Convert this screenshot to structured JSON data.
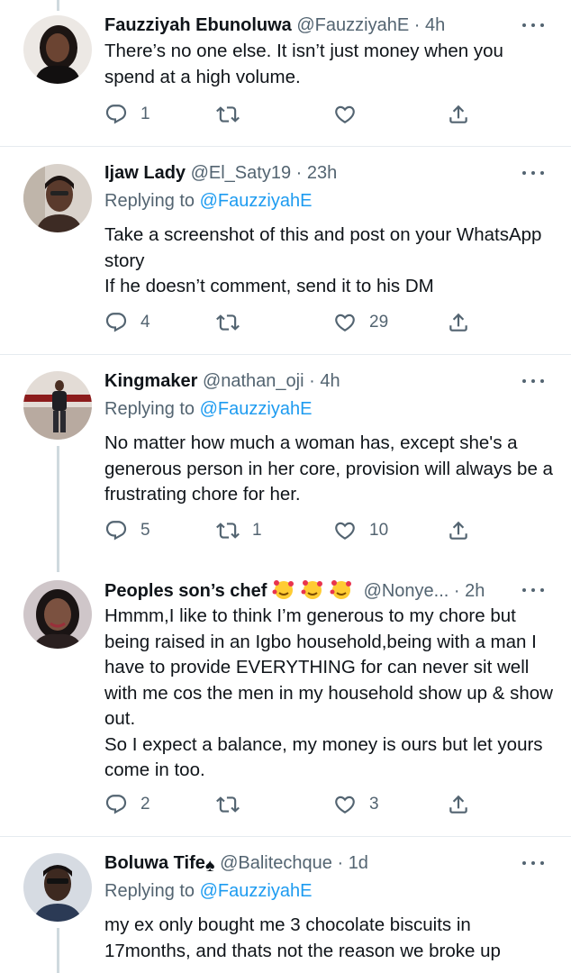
{
  "tweets": [
    {
      "name": "Fauzziyah Ebunoluwa",
      "handle": "@FauzziyahE",
      "time": "4h",
      "replying_label": "",
      "replying_to": "",
      "text": "There’s no one else. It isn’t just money when you spend at a high volume.",
      "replies": "1",
      "retweets": "",
      "likes": ""
    },
    {
      "name": "Ijaw Lady",
      "handle": "@El_Saty19",
      "time": "23h",
      "replying_label": "Replying to",
      "replying_to": "@FauzziyahE",
      "text": "Take a screenshot of this and post on your WhatsApp story\nIf he doesn’t comment, send it to his DM",
      "replies": "4",
      "retweets": "",
      "likes": "29"
    },
    {
      "name": "Kingmaker",
      "handle": "@nathan_oji",
      "time": "4h",
      "replying_label": "Replying to",
      "replying_to": "@FauzziyahE",
      "text": "No matter how much a woman has, except she's a generous person in her core, provision will always be a frustrating chore for her.",
      "replies": "5",
      "retweets": "1",
      "likes": "10"
    },
    {
      "name": "Peoples son’s chef",
      "name_emojis": "🥰🥰🥰",
      "handle": "@Nonye...",
      "time": "2h",
      "replying_label": "",
      "replying_to": "",
      "text": "Hmmm,I like to think I’m generous to my chore but being raised in an Igbo household,being with a man I have to provide EVERYTHING for can never sit well with me cos the men in my household show up & show out.\nSo I expect a balance, my money is ours but let yours come in too.",
      "replies": "2",
      "retweets": "",
      "likes": "3"
    },
    {
      "name": "Boluwa Tife",
      "name_suffix": "♠",
      "handle": "@Balitechque",
      "time": "1d",
      "replying_label": "Replying to",
      "replying_to": "@FauzziyahE",
      "text": "my ex only bought me 3 chocolate biscuits in 17months, and thats not the reason we broke up",
      "replies": "",
      "retweets": "",
      "likes": ""
    }
  ],
  "separator": "·",
  "icons": {
    "reply": "reply-icon",
    "retweet": "retweet-icon",
    "like": "heart-icon",
    "share": "share-icon",
    "more": "more-icon"
  },
  "colors": {
    "link": "#1d9bf0",
    "secondary": "#536471",
    "divider": "#e6ebef"
  }
}
